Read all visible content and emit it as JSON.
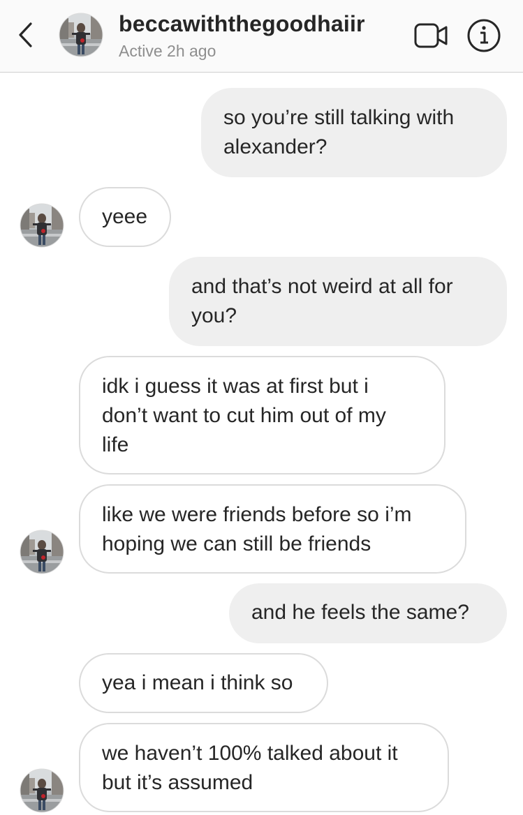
{
  "header": {
    "username": "beccawiththegoodhaiir",
    "status": "Active 2h ago",
    "back_icon": "chevron-left-icon",
    "video_icon": "video-camera-icon",
    "info_icon": "info-icon"
  },
  "colors": {
    "sent_bubble": "#efefef",
    "received_border": "#dbdbdb",
    "text": "#262626",
    "muted": "#8e8e8e",
    "header_bg": "#fafafa"
  },
  "messages": [
    {
      "sender": "me",
      "lines": [
        "so you’re still talking with",
        "alexander?"
      ]
    },
    {
      "sender": "them",
      "lines": [
        "yeee"
      ]
    },
    {
      "sender": "me",
      "lines": [
        "and that’s not weird at all for",
        "you?"
      ]
    },
    {
      "sender": "them",
      "lines": [
        "idk i guess it was at first but i",
        "don’t want to cut him out of my",
        "life"
      ]
    },
    {
      "sender": "them",
      "lines": [
        "like we were friends before so i’m",
        "hoping we can still be friends"
      ]
    },
    {
      "sender": "me",
      "lines": [
        "and he feels the same?"
      ]
    },
    {
      "sender": "them",
      "lines": [
        "yea i mean i think so"
      ]
    },
    {
      "sender": "them",
      "lines": [
        "we haven’t 100% talked about it",
        "but it’s assumed"
      ]
    }
  ]
}
